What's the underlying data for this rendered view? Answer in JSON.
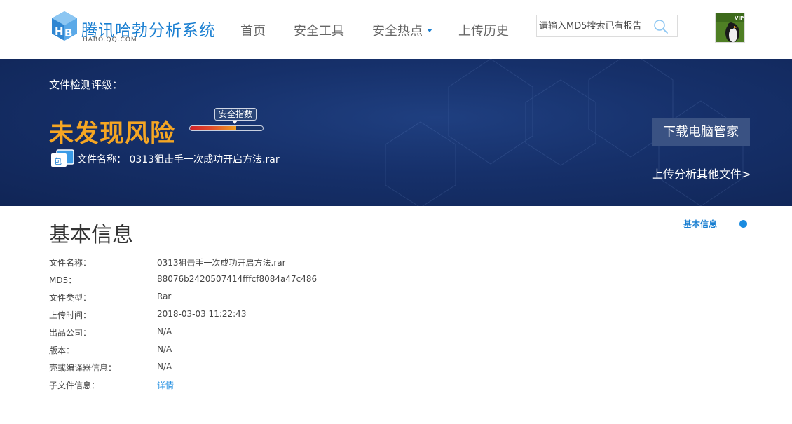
{
  "header": {
    "logo_title": "腾讯哈勃分析系统",
    "logo_subtitle": "HABO.QQ.COM",
    "nav": [
      {
        "label": "首页"
      },
      {
        "label": "安全工具"
      },
      {
        "label": "安全热点"
      },
      {
        "label": "上传历史"
      }
    ],
    "search": {
      "placeholder": "请输入MD5搜索已有报告",
      "value": ""
    },
    "avatar_badge": "VIP",
    "accent_color": "#1a7fd1"
  },
  "banner": {
    "label": "文件检测评级：",
    "risk_level": "未发现风险",
    "score_label": "安全指数",
    "score_fraction": 0.63,
    "file_icon_text": "包",
    "file_name_label": "文件名称：",
    "file_name": "0313狙击手一次成功开启方法.rar",
    "download_button": "下载电脑管家",
    "upload_link": "上传分析其他文件>",
    "risk_color": "#f5a623"
  },
  "basic_info": {
    "title": "基本信息",
    "side_nav_label": "基本信息",
    "rows": [
      {
        "key": "文件名称：",
        "value": "0313狙击手一次成功开启方法.rar"
      },
      {
        "key": "MD5：",
        "value": "88076b2420507414fffcf8084a47c486"
      },
      {
        "key": "文件类型：",
        "value": "Rar"
      },
      {
        "key": "上传时间：",
        "value": "2018-03-03 11:22:43"
      },
      {
        "key": "出品公司：",
        "value": "N/A"
      },
      {
        "key": "版本：",
        "value": "N/A"
      },
      {
        "key": "壳或编译器信息：",
        "value": "N/A"
      },
      {
        "key": "子文件信息：",
        "value": "详情"
      }
    ]
  }
}
